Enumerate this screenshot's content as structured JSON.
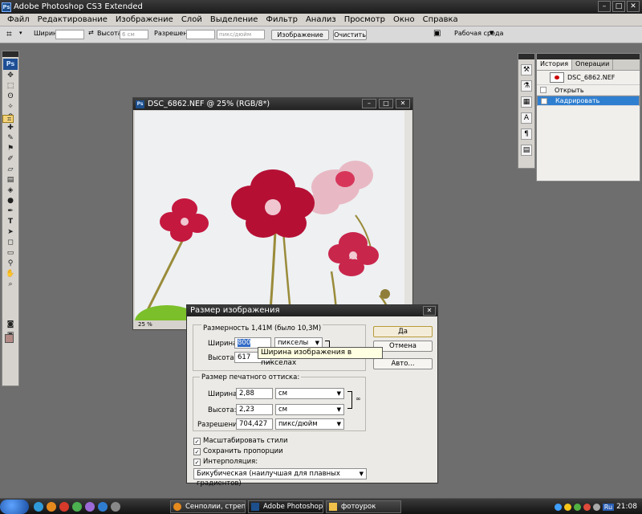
{
  "app": {
    "title": "Adobe Photoshop CS3 Extended",
    "logo": "Ps"
  },
  "menu": [
    "Файл",
    "Редактирование",
    "Изображение",
    "Слой",
    "Выделение",
    "Фильтр",
    "Анализ",
    "Просмотр",
    "Окно",
    "Справка"
  ],
  "options_bar": {
    "width_label": "Ширина:",
    "height_label": "Высота:",
    "height_value": "6 см",
    "resolution_label": "Разрешение:",
    "resolution_unit": "пикс/дюйм",
    "image_button": "Изображение",
    "clear_button": "Очистить",
    "workspace_label": "Рабочая среда"
  },
  "document": {
    "title": "DSC_6862.NEF @ 25% (RGB/8*)",
    "zoom": "25 %"
  },
  "history_panel": {
    "tabs": [
      "История",
      "Операции"
    ],
    "snapshot": "DSC_6862.NEF",
    "items": [
      "Открыть",
      "Кадрировать"
    ]
  },
  "dialog": {
    "title": "Размер изображения",
    "pixel_dims_label": "Размерность:",
    "pixel_dims_value": "1,41M (было 10,3M)",
    "width_label": "Ширина:",
    "width_value": "800",
    "width_unit": "пикселы",
    "height_label": "Высота:",
    "height_value": "617",
    "doc_size_label": "Размер печатного оттиска:",
    "doc_width_label": "Ширина:",
    "doc_width_value": "2,88",
    "doc_width_unit": "см",
    "doc_height_label": "Высота:",
    "doc_height_value": "2,23",
    "doc_height_unit": "см",
    "resolution_label": "Разрешение:",
    "resolution_value": "704,427",
    "resolution_unit": "пикс/дюйм",
    "checkboxes": [
      "Масштабировать стили",
      "Сохранить пропорции",
      "Интерполяция:"
    ],
    "interpolation": "Бикубическая (наилучшая для плавных градиентов)",
    "ok_button": "Да",
    "cancel_button": "Отмена",
    "auto_button": "Авто...",
    "tooltip": "Ширина изображения в пикселах"
  },
  "taskbar": {
    "tasks": [
      "Сенполии, стрепт...",
      "Adobe Photoshop ...",
      "фотоурок"
    ],
    "clock": "21:08",
    "lang": "Ru"
  },
  "colors": {
    "foreground_swatch": "#b38a84",
    "accent_selection": "#2f7fd1"
  }
}
